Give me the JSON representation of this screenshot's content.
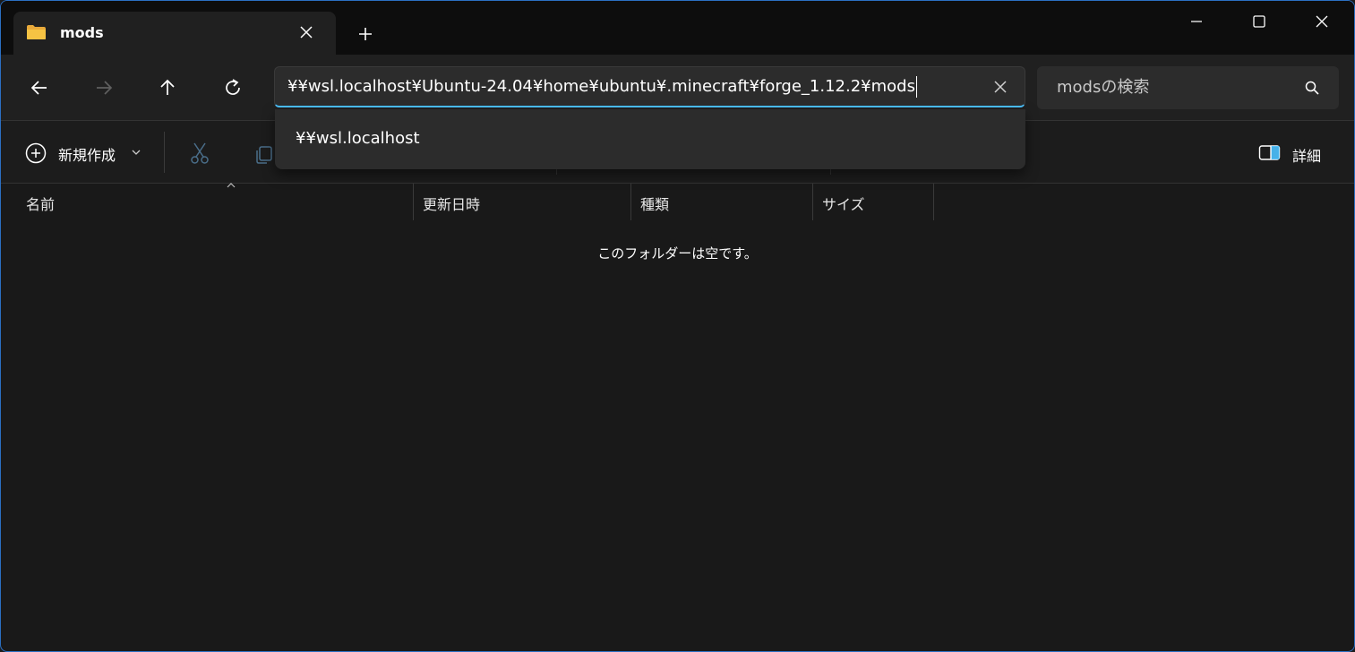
{
  "tab": {
    "title": "mods"
  },
  "address": {
    "path": "¥¥wsl.localhost¥Ubuntu-24.04¥home¥ubuntu¥.minecraft¥forge_1.12.2¥mods"
  },
  "search": {
    "placeholder": "modsの検索"
  },
  "toolbar": {
    "new_label": "新規作成",
    "details_label": "詳細"
  },
  "dropdown": {
    "items": [
      "¥¥wsl.localhost"
    ]
  },
  "columns": [
    "名前",
    "更新日時",
    "種類",
    "サイズ"
  ],
  "content": {
    "empty_message": "このフォルダーは空です。"
  },
  "colors": {
    "accent": "#4cc2ff",
    "background": "#191919",
    "folder": "#f6c343"
  }
}
